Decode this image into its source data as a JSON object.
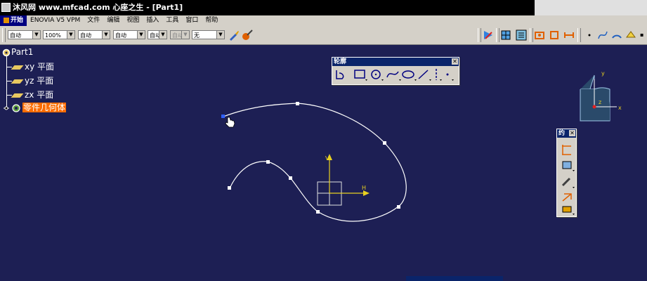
{
  "window": {
    "title": "沐风网 www.mfcad.com 心座之生 - [Part1]"
  },
  "menu": {
    "items": [
      "开始",
      "ENOVIA V5 VPM",
      "文件",
      "编辑",
      "视图",
      "插入",
      "工具",
      "窗口",
      "帮助"
    ]
  },
  "toolbar": {
    "combo1": "自动",
    "combo2": "100%",
    "combo3": "自动",
    "combo4": "自动",
    "combo5": "自动",
    "combo6": "自动",
    "combo7": "无"
  },
  "tree": {
    "root": "Part1",
    "plane_xy": "xy 平面",
    "plane_yz": "yz 平面",
    "plane_zx": "zx 平面",
    "body": "零件几何体"
  },
  "profile_toolbar": {
    "title": "轮廓"
  },
  "constraint_toolbar": {
    "title": "约"
  },
  "compass": {
    "x_label": "x",
    "y_label": "y",
    "z_label": "z"
  },
  "sketch_axes": {
    "v_label": "V",
    "h_label": "H"
  },
  "colors": {
    "background": "#1d1f54",
    "highlight": "#ff6c00",
    "panel_title": "#0a246a",
    "axis": "#e8d020"
  }
}
